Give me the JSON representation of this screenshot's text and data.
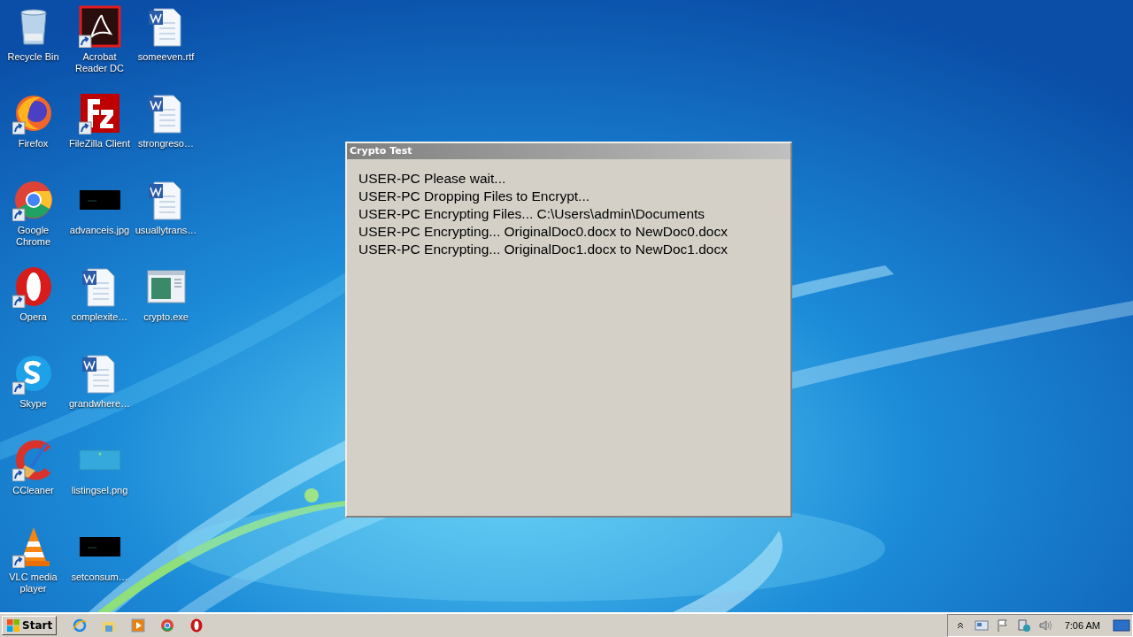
{
  "desktop": {
    "icons": [
      {
        "label": "Recycle Bin",
        "kind": "recycle",
        "shortcut": false
      },
      {
        "label": "Firefox",
        "kind": "firefox",
        "shortcut": true
      },
      {
        "label": "Google Chrome",
        "kind": "chrome",
        "shortcut": true
      },
      {
        "label": "Opera",
        "kind": "opera",
        "shortcut": true
      },
      {
        "label": "Skype",
        "kind": "skype",
        "shortcut": true
      },
      {
        "label": "CCleaner",
        "kind": "ccleaner",
        "shortcut": true
      },
      {
        "label": "VLC media player",
        "kind": "vlc",
        "shortcut": true
      },
      {
        "label": "Acrobat Reader DC",
        "kind": "acrobat",
        "shortcut": true
      },
      {
        "label": "FileZilla Client",
        "kind": "filezilla",
        "shortcut": true
      },
      {
        "label": "advanceis.jpg",
        "kind": "dark-image",
        "shortcut": false
      },
      {
        "label": "complexite…",
        "kind": "word",
        "shortcut": false
      },
      {
        "label": "grandwhere…",
        "kind": "word",
        "shortcut": false
      },
      {
        "label": "listingsel.png",
        "kind": "light-image",
        "shortcut": false
      },
      {
        "label": "setconsum…",
        "kind": "dark-image",
        "shortcut": false
      },
      {
        "label": "someeven.rtf",
        "kind": "word",
        "shortcut": false
      },
      {
        "label": "strongreso…",
        "kind": "word",
        "shortcut": false
      },
      {
        "label": "usuallytrans…",
        "kind": "word",
        "shortcut": false
      },
      {
        "label": "crypto.exe",
        "kind": "exe",
        "shortcut": false
      }
    ]
  },
  "window": {
    "title": "Crypto Test",
    "lines": [
      "USER-PC Please wait...",
      "USER-PC Dropping Files to Encrypt...",
      "USER-PC Encrypting Files... C:\\Users\\admin\\Documents",
      "USER-PC Encrypting... OriginalDoc0.docx to NewDoc0.docx",
      "USER-PC Encrypting... OriginalDoc1.docx to NewDoc1.docx"
    ]
  },
  "taskbar": {
    "start": "Start",
    "apps": [
      {
        "kind": "ie"
      },
      {
        "kind": "explorer"
      },
      {
        "kind": "media"
      },
      {
        "kind": "chrome"
      },
      {
        "kind": "opera"
      }
    ],
    "tray": {
      "clock": "7:06 AM"
    }
  }
}
